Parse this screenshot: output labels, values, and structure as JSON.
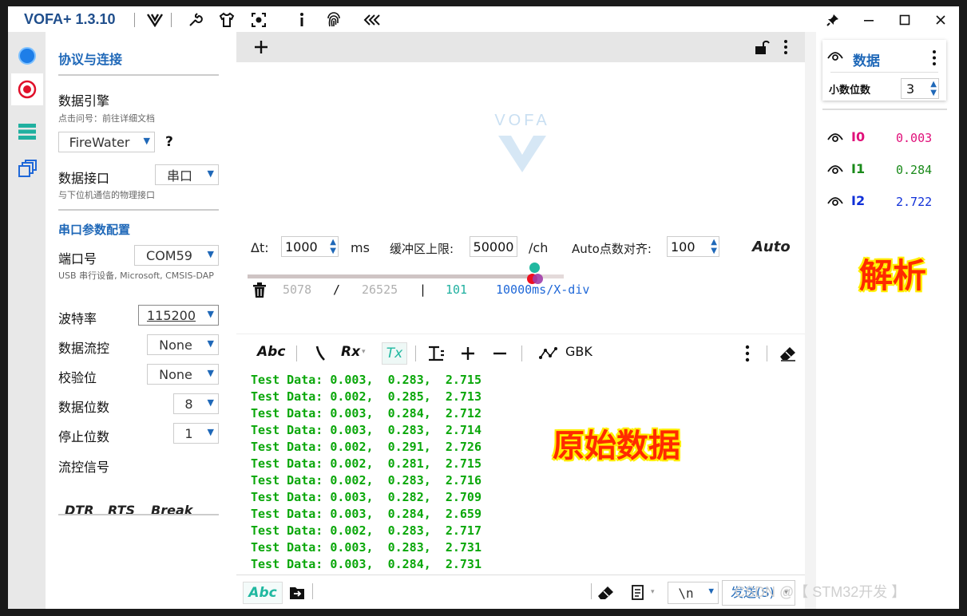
{
  "app": {
    "title": "VOFA+ 1.3.10"
  },
  "left": {
    "section_protocol": "协议与连接",
    "engine_label": "数据引擎",
    "engine_hint": "点击问号：前往详细文档",
    "engine_value": "FireWater",
    "engine_help": "?",
    "interface_label": "数据接口",
    "interface_value": "串口",
    "interface_hint": "与下位机通信的物理接口",
    "section_serial": "串口参数配置",
    "port_label": "端口号",
    "port_value": "COM59",
    "port_hint": "USB 串行设备, Microsoft, CMSIS-DAP",
    "baud_label": "波特率",
    "baud_value": "115200",
    "flowctl_label": "数据流控",
    "flowctl_value": "None",
    "parity_label": "校验位",
    "parity_value": "None",
    "databits_label": "数据位数",
    "databits_value": "8",
    "stopbits_label": "停止位数",
    "stopbits_value": "1",
    "signal_label": "流控信号",
    "signals": [
      "DTR",
      "RTS",
      "Break"
    ]
  },
  "center": {
    "watermark": "VOFA",
    "dt_label": "Δt:",
    "dt_value": "1000",
    "dt_unit": "ms",
    "buffer_label": "缓冲区上限:",
    "buffer_value": "50000",
    "buffer_unit": "/ch",
    "align_label": "Auto点数对齐:",
    "align_value": "100",
    "auto_label": "Auto",
    "slider_level": 0.92,
    "stats": {
      "a": "5078",
      "sep1": "/",
      "b": "26525",
      "sep2": "|",
      "c": "101",
      "div": "10000ms/X-div"
    },
    "toolbar": {
      "abc": "Abc",
      "rx": "Rx",
      "tx": "Tx",
      "encoding": "GBK"
    },
    "log_lines": [
      "Test Data: 0.003,  0.283,  2.715",
      "Test Data: 0.002,  0.285,  2.713",
      "Test Data: 0.003,  0.284,  2.712",
      "Test Data: 0.003,  0.283,  2.714",
      "Test Data: 0.002,  0.291,  2.726",
      "Test Data: 0.002,  0.281,  2.715",
      "Test Data: 0.002,  0.283,  2.716",
      "Test Data: 0.003,  0.282,  2.709",
      "Test Data: 0.003,  0.284,  2.659",
      "Test Data: 0.002,  0.283,  2.717",
      "Test Data: 0.003,  0.283,  2.731",
      "Test Data: 0.003,  0.284,  2.731"
    ],
    "annotation_raw": "原始数据",
    "send": {
      "abc": "Abc",
      "newline": "\\n",
      "send_label": "发送(S)"
    }
  },
  "right": {
    "title": "数据",
    "decimals_label": "小数位数",
    "decimals_value": "3",
    "channels": [
      {
        "name": "I0",
        "value": "0.003",
        "color": "#e0107a"
      },
      {
        "name": "I1",
        "value": "0.284",
        "color": "#1a8a1a"
      },
      {
        "name": "I2",
        "value": "2.722",
        "color": "#1030d8"
      }
    ],
    "annotation_parse": "解析"
  },
  "watermark": "CSDN @【 STM32开发 】",
  "colors": {
    "accent": "#1f68b8",
    "log_text": "#0aa70a",
    "annotation": "#ff2a00"
  }
}
